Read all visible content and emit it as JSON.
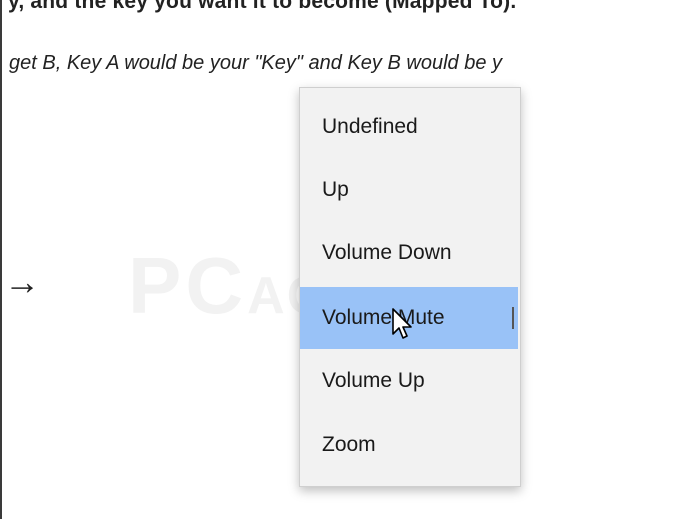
{
  "article": {
    "top_line": "y, and the key you want it to become (Mapped To).",
    "italic_line": "get B, Key A would be your \"Key\" and Key B would be y",
    "arrow": "→"
  },
  "watermark": {
    "big": "PC",
    "small": "ACTION"
  },
  "dropdown": {
    "options": [
      {
        "label": "Undefined"
      },
      {
        "label": "Up"
      },
      {
        "label": "Volume Down"
      },
      {
        "label": "Volume Mute",
        "selected": true
      },
      {
        "label": "Volume Up"
      },
      {
        "label": "Zoom"
      }
    ],
    "highlight_color": "#99c2f7"
  },
  "cursor": {
    "icon": "mouse-pointer-icon"
  }
}
